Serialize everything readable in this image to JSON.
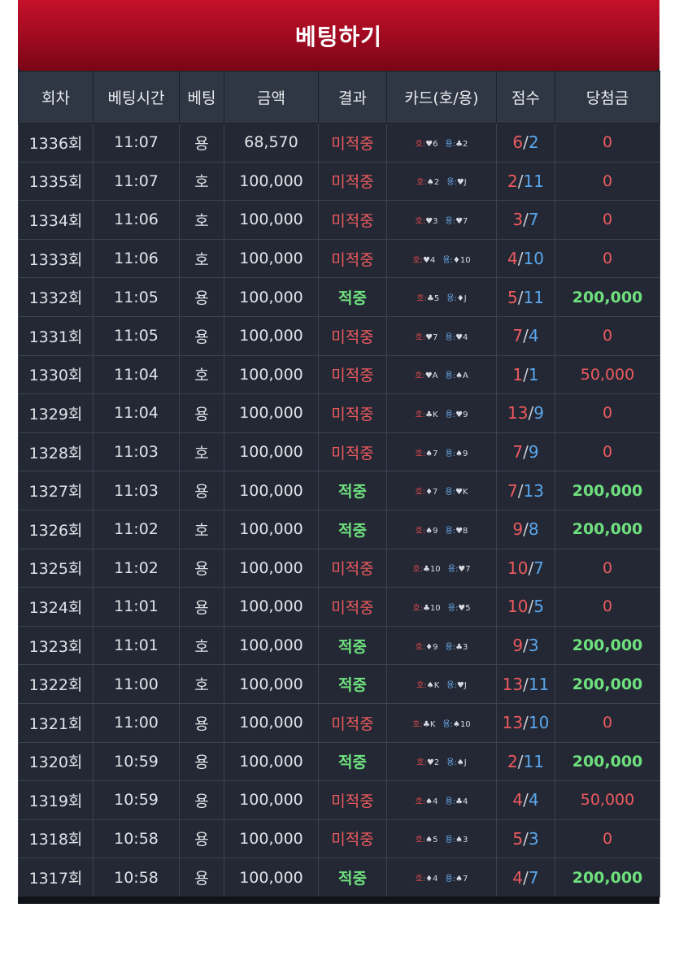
{
  "title": "베팅하기",
  "headers": [
    "회차",
    "베팅시간",
    "베팅",
    "금액",
    "결과",
    "카드(호/용)",
    "점수",
    "당첨금"
  ],
  "card_labels": {
    "tiger": "호:",
    "dragon": "용:"
  },
  "rows": [
    {
      "round": "1336회",
      "time": "11:07",
      "bet": "용",
      "amount": "68,570",
      "result": "미적중",
      "tiger_card": "♥6",
      "dragon_card": "♣2",
      "tiger_score": "6",
      "dragon_score": "2",
      "winnings": "0"
    },
    {
      "round": "1335회",
      "time": "11:07",
      "bet": "호",
      "amount": "100,000",
      "result": "미적중",
      "tiger_card": "♠2",
      "dragon_card": "♥J",
      "tiger_score": "2",
      "dragon_score": "11",
      "winnings": "0"
    },
    {
      "round": "1334회",
      "time": "11:06",
      "bet": "호",
      "amount": "100,000",
      "result": "미적중",
      "tiger_card": "♥3",
      "dragon_card": "♥7",
      "tiger_score": "3",
      "dragon_score": "7",
      "winnings": "0"
    },
    {
      "round": "1333회",
      "time": "11:06",
      "bet": "호",
      "amount": "100,000",
      "result": "미적중",
      "tiger_card": "♥4",
      "dragon_card": "♦10",
      "tiger_score": "4",
      "dragon_score": "10",
      "winnings": "0"
    },
    {
      "round": "1332회",
      "time": "11:05",
      "bet": "용",
      "amount": "100,000",
      "result": "적중",
      "tiger_card": "♣5",
      "dragon_card": "♦J",
      "tiger_score": "5",
      "dragon_score": "11",
      "winnings": "200,000"
    },
    {
      "round": "1331회",
      "time": "11:05",
      "bet": "용",
      "amount": "100,000",
      "result": "미적중",
      "tiger_card": "♥7",
      "dragon_card": "♥4",
      "tiger_score": "7",
      "dragon_score": "4",
      "winnings": "0"
    },
    {
      "round": "1330회",
      "time": "11:04",
      "bet": "호",
      "amount": "100,000",
      "result": "미적중",
      "tiger_card": "♥A",
      "dragon_card": "♠A",
      "tiger_score": "1",
      "dragon_score": "1",
      "winnings": "50,000"
    },
    {
      "round": "1329회",
      "time": "11:04",
      "bet": "용",
      "amount": "100,000",
      "result": "미적중",
      "tiger_card": "♣K",
      "dragon_card": "♥9",
      "tiger_score": "13",
      "dragon_score": "9",
      "winnings": "0"
    },
    {
      "round": "1328회",
      "time": "11:03",
      "bet": "호",
      "amount": "100,000",
      "result": "미적중",
      "tiger_card": "♠7",
      "dragon_card": "♠9",
      "tiger_score": "7",
      "dragon_score": "9",
      "winnings": "0"
    },
    {
      "round": "1327회",
      "time": "11:03",
      "bet": "용",
      "amount": "100,000",
      "result": "적중",
      "tiger_card": "♦7",
      "dragon_card": "♥K",
      "tiger_score": "7",
      "dragon_score": "13",
      "winnings": "200,000"
    },
    {
      "round": "1326회",
      "time": "11:02",
      "bet": "호",
      "amount": "100,000",
      "result": "적중",
      "tiger_card": "♠9",
      "dragon_card": "♥8",
      "tiger_score": "9",
      "dragon_score": "8",
      "winnings": "200,000"
    },
    {
      "round": "1325회",
      "time": "11:02",
      "bet": "용",
      "amount": "100,000",
      "result": "미적중",
      "tiger_card": "♣10",
      "dragon_card": "♥7",
      "tiger_score": "10",
      "dragon_score": "7",
      "winnings": "0"
    },
    {
      "round": "1324회",
      "time": "11:01",
      "bet": "용",
      "amount": "100,000",
      "result": "미적중",
      "tiger_card": "♣10",
      "dragon_card": "♥5",
      "tiger_score": "10",
      "dragon_score": "5",
      "winnings": "0"
    },
    {
      "round": "1323회",
      "time": "11:01",
      "bet": "호",
      "amount": "100,000",
      "result": "적중",
      "tiger_card": "♦9",
      "dragon_card": "♣3",
      "tiger_score": "9",
      "dragon_score": "3",
      "winnings": "200,000"
    },
    {
      "round": "1322회",
      "time": "11:00",
      "bet": "호",
      "amount": "100,000",
      "result": "적중",
      "tiger_card": "♠K",
      "dragon_card": "♥J",
      "tiger_score": "13",
      "dragon_score": "11",
      "winnings": "200,000"
    },
    {
      "round": "1321회",
      "time": "11:00",
      "bet": "용",
      "amount": "100,000",
      "result": "미적중",
      "tiger_card": "♣K",
      "dragon_card": "♠10",
      "tiger_score": "13",
      "dragon_score": "10",
      "winnings": "0"
    },
    {
      "round": "1320회",
      "time": "10:59",
      "bet": "용",
      "amount": "100,000",
      "result": "적중",
      "tiger_card": "♥2",
      "dragon_card": "♠J",
      "tiger_score": "2",
      "dragon_score": "11",
      "winnings": "200,000"
    },
    {
      "round": "1319회",
      "time": "10:59",
      "bet": "용",
      "amount": "100,000",
      "result": "미적중",
      "tiger_card": "♠4",
      "dragon_card": "♣4",
      "tiger_score": "4",
      "dragon_score": "4",
      "winnings": "50,000"
    },
    {
      "round": "1318회",
      "time": "10:58",
      "bet": "용",
      "amount": "100,000",
      "result": "미적중",
      "tiger_card": "♠5",
      "dragon_card": "♠3",
      "tiger_score": "5",
      "dragon_score": "3",
      "winnings": "0"
    },
    {
      "round": "1317회",
      "time": "10:58",
      "bet": "용",
      "amount": "100,000",
      "result": "적중",
      "tiger_card": "♦4",
      "dragon_card": "♠7",
      "tiger_score": "4",
      "dragon_score": "7",
      "winnings": "200,000"
    }
  ],
  "colors": {
    "title_red": "#b00d24",
    "panel_bg": "#1c2029",
    "miss_red": "#ec5a5e",
    "hit_green": "#6fe07e",
    "dragon_blue": "#5aa6ec"
  }
}
